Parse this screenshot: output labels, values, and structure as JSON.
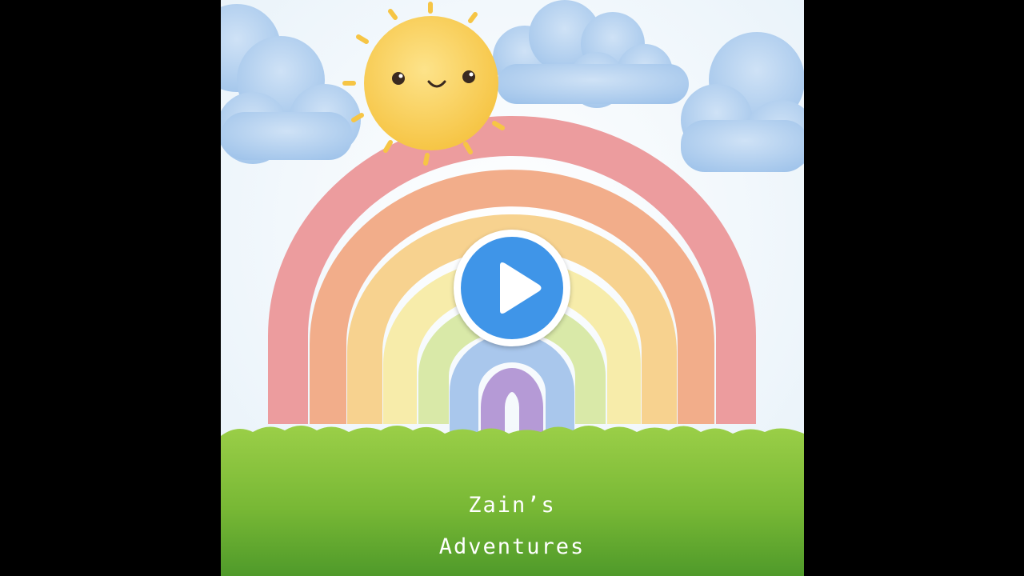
{
  "video": {
    "title_line1": "Zain’s",
    "title_line2": "Adventures",
    "play_button_icon": "play-icon"
  },
  "colors": {
    "letterbox": "#000000",
    "sky": "#eef6fb",
    "grass": "#8cc63f",
    "play_accent": "#3f95e8"
  }
}
